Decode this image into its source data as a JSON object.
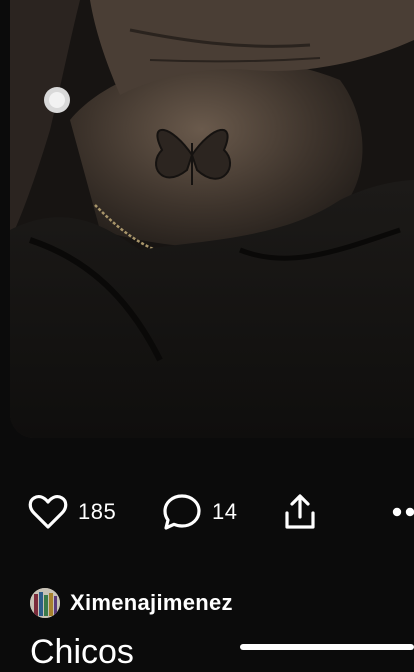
{
  "pin": {
    "image_alt": "",
    "likes": "185",
    "comments": "14"
  },
  "actions": {
    "like_icon": "heart-outline-icon",
    "comment_icon": "speech-bubble-icon",
    "share_icon": "share-upload-icon",
    "more_icon": "more-dots-icon"
  },
  "author": {
    "name": "Ximenajimenez",
    "avatar_icon": "user-avatar"
  },
  "board": {
    "title": "Chicos"
  },
  "colors": {
    "background": "#0b0b0b",
    "text": "#ffffff"
  }
}
